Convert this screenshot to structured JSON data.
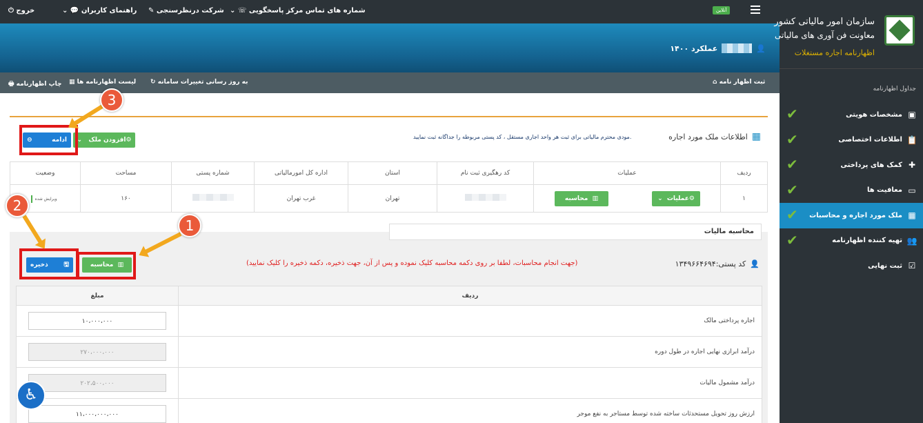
{
  "sidebar": {
    "brand_line1": "سازمان امور مالیاتی کشور",
    "brand_line2": "معاونت فن آوری های مالیاتی",
    "brand_line3": "اظهارنامه اجاره مستغلات",
    "heading": "جداول اظهارنامه",
    "items": [
      {
        "label": "مشخصات هویتی",
        "icon": "id-card-icon"
      },
      {
        "label": "اطلاعات اختصاصی",
        "icon": "clipboard-icon"
      },
      {
        "label": "کمک های پرداختی",
        "icon": "medkit-icon"
      },
      {
        "label": "معافیت ها",
        "icon": "screen-icon"
      },
      {
        "label": "ملک مورد اجاره و محاسبات",
        "icon": "building-icon"
      },
      {
        "label": "تهیه کننده اظهارنامه",
        "icon": "users-icon"
      },
      {
        "label": "ثبت نهایی",
        "icon": "check-doc-icon"
      }
    ],
    "active_index": 4
  },
  "topbar": {
    "online": "آنلاین",
    "contact": "شماره های تماس مرکز پاسخگویی",
    "survey": "شرکت درنظرسنجی",
    "guide": "راهنمای کاربران",
    "logout": "خروج"
  },
  "banner": {
    "title": "عملکرد ۱۴۰۰"
  },
  "actions": {
    "register": "ثبت اظهار نامه",
    "update": "به روز رسانی تغییرات سامانه",
    "list": "لیست اظهارنامه ها",
    "print": "چاپ اظهارنامه"
  },
  "property": {
    "title": "اطلاعات ملک مورد اجاره",
    "note": "مودی محترم مالیاتی برای ثبت هر واحد اجاری مستقل ، کد پستی مربوطه را جداگانه ثبت نمایید.",
    "add_button": "افزودن ملک",
    "continue_button": "ادامه",
    "columns": [
      "ردیف",
      "عملیات",
      "کد رهگیری ثبت نام",
      "استان",
      "اداره کل امورمالیاتی",
      "شماره پستی",
      "مساحت",
      "وضعیت"
    ],
    "row": {
      "index": "۱",
      "ops_button": "عملیات",
      "calc_button": "محاسبه",
      "province": "تهران",
      "office": "غرب تهران",
      "area": "۱۶۰",
      "status": "ویرایش شده"
    }
  },
  "calc": {
    "title": "محاسبه مالیات",
    "postal_label": "کد پستی:۱۳۴۹۶۶۴۶۹۴",
    "note": "(جهت انجام محاسبات، لطفا بر روی دکمه محاسبه کلیک نموده و پس از آن، جهت ذخیره، دکمه ذخیره را کلیک نمایید)",
    "calc_button": "محاسبه",
    "save_button": "ذخیره",
    "col_row": "ردیف",
    "col_amount": "مبلغ",
    "rows": [
      {
        "label": "اجاره پرداختی مالک",
        "value": "۱۰،۰۰۰،۰۰۰"
      },
      {
        "label": "درآمد ابرازی نهایی اجاره در طول دوره",
        "value": "۲۷۰،۰۰۰،۰۰۰"
      },
      {
        "label": "درآمد مشمول مالیات",
        "value": "۲۰۲،۵۰۰،۰۰۰"
      },
      {
        "label": "ارزش روز تحویل مستحدثات ساخته شده توسط مستاجر به نفع موجر",
        "value": "۱۱،۰۰۰،۰۰۰،۰۰۰"
      }
    ]
  },
  "callouts": [
    "1",
    "2",
    "3"
  ],
  "colors": {
    "accent": "#1b8ec5",
    "green": "#5cb85c",
    "blue": "#1e7fd6",
    "highlight": "#e01818",
    "callout": "#ea5a3a"
  }
}
